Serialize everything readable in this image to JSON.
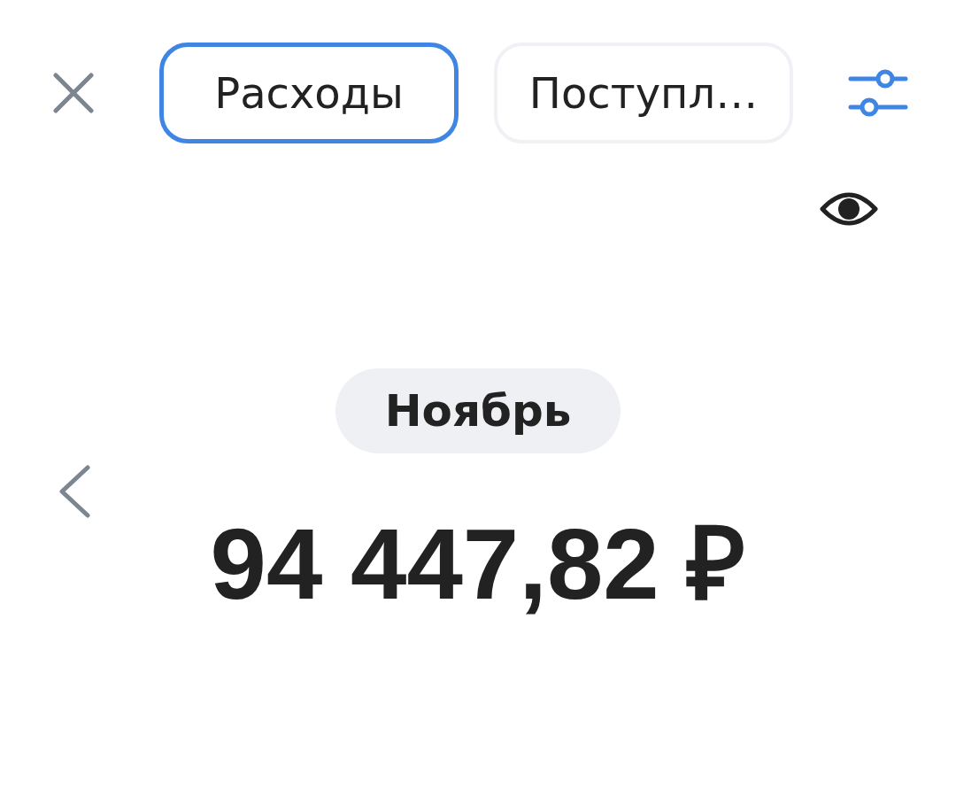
{
  "tabs": [
    {
      "label": "Расходы",
      "selected": true
    },
    {
      "label": "Поступл…",
      "selected": false
    }
  ],
  "month": {
    "label": "Ноябрь"
  },
  "amount": "94 447,82 ₽"
}
